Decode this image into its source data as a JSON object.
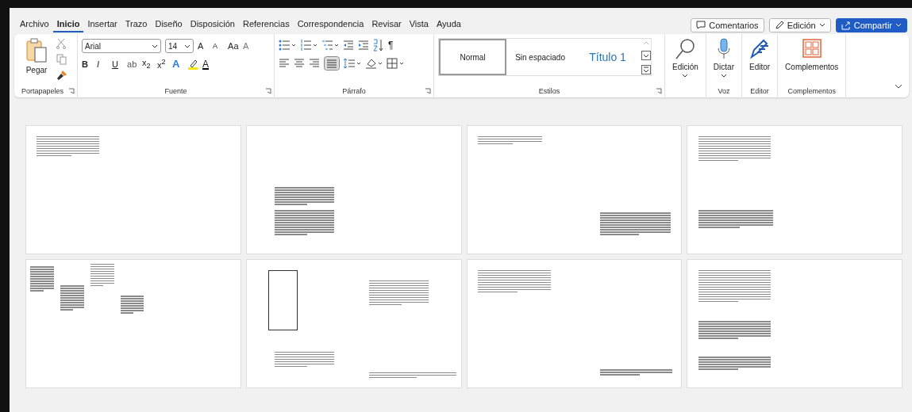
{
  "tabs": [
    {
      "label": "Archivo",
      "selected": false
    },
    {
      "label": "Inicio",
      "selected": true
    },
    {
      "label": "Insertar",
      "selected": false
    },
    {
      "label": "Trazo",
      "selected": false
    },
    {
      "label": "Diseño",
      "selected": false
    },
    {
      "label": "Disposición",
      "selected": false
    },
    {
      "label": "Referencias",
      "selected": false
    },
    {
      "label": "Correspondencia",
      "selected": false
    },
    {
      "label": "Revisar",
      "selected": false
    },
    {
      "label": "Vista",
      "selected": false
    },
    {
      "label": "Ayuda",
      "selected": false
    }
  ],
  "top_buttons": [
    {
      "kind": "comments",
      "label": "Comentarios"
    },
    {
      "kind": "editing",
      "label": "Edición"
    },
    {
      "kind": "share",
      "label": "Compartir"
    }
  ],
  "clipboard": {
    "paste": "Pegar",
    "group": "Portapapeles"
  },
  "font": {
    "name": "Arial",
    "size": "14",
    "row1": [
      {
        "kind": "grow",
        "label": "A"
      },
      {
        "kind": "shrink",
        "label": "A"
      },
      {
        "kind": "case",
        "label": "Aa"
      },
      {
        "kind": "clear",
        "label": "A"
      }
    ],
    "row2": [
      {
        "kind": "bold",
        "label": "B"
      },
      {
        "kind": "italic",
        "label": "I"
      },
      {
        "kind": "underline",
        "label": "U"
      },
      {
        "kind": "strike",
        "label": "ab"
      },
      {
        "kind": "script",
        "label": "x$_{2}$"
      },
      {
        "kind": "script",
        "label": "x$^{2}$"
      },
      {
        "kind": "effects",
        "label": "A"
      },
      {
        "kind": "highlight"
      },
      {
        "kind": "color",
        "label": "A"
      }
    ],
    "group": "Fuente"
  },
  "paragraph": {
    "pilcrow": "¶",
    "group": "Párrafo"
  },
  "styles": {
    "items": [
      {
        "kind": "normal",
        "label": "Normal",
        "selected": true
      },
      {
        "kind": "normal",
        "label": "Sin espaciado",
        "selected": false
      },
      {
        "kind": "heading",
        "label": "Título 1",
        "selected": false
      }
    ],
    "group": "Estilos"
  },
  "commands": [
    {
      "kind": "search",
      "label": "Edición"
    },
    {
      "kind": "mic",
      "label": "Dictar",
      "group": "Voz"
    },
    {
      "kind": "editor",
      "label": "Editor",
      "group": "Editor"
    },
    {
      "kind": "addins",
      "label": "Complementos",
      "group": "Complementos"
    }
  ],
  "pages": [
    {
      "kind": "text"
    },
    {
      "kind": "text"
    },
    {
      "kind": "text"
    },
    {
      "kind": "text"
    },
    {
      "kind": "columns"
    },
    {
      "kind": "shape"
    },
    {
      "kind": "text"
    },
    {
      "kind": "text"
    }
  ]
}
